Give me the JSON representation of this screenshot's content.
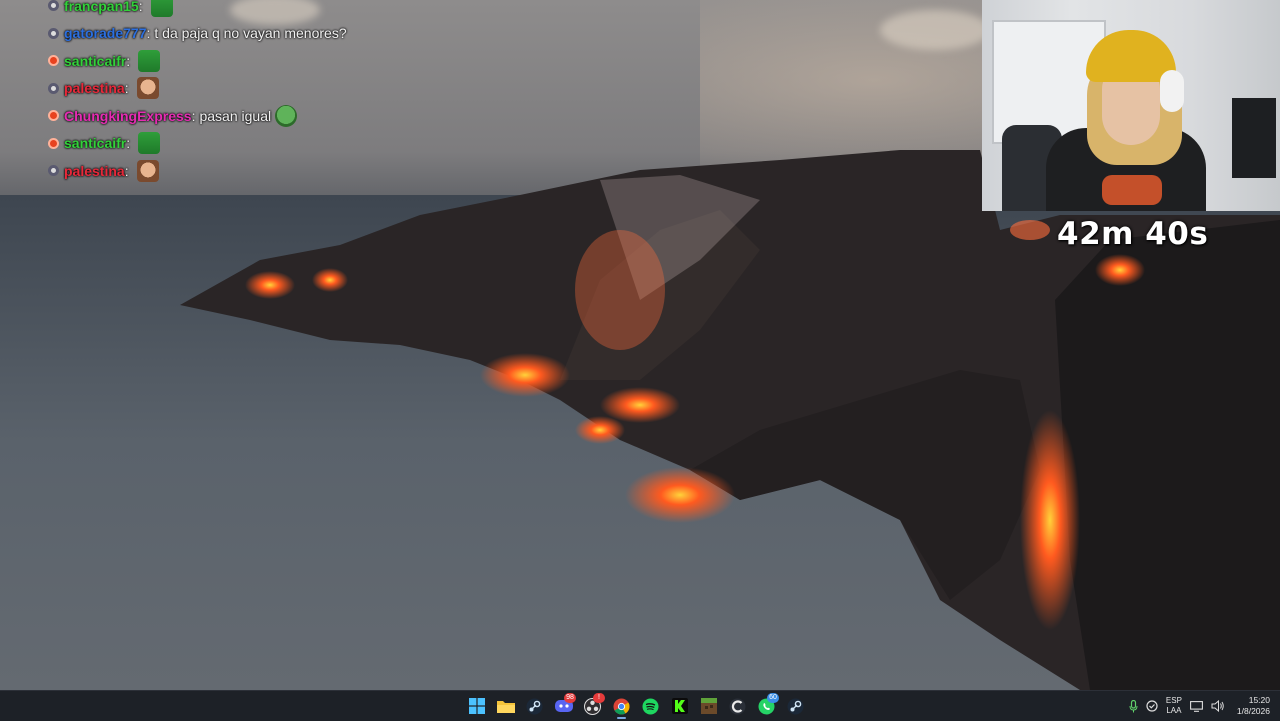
{
  "chat": {
    "messages": [
      {
        "badge": "gray",
        "user": "francpan15",
        "user_color": "#32d23a",
        "text": "",
        "emote": "green"
      },
      {
        "badge": "gray",
        "user": "gatorade777",
        "user_color": "#2b6fe0",
        "text": "t da paja q no vayan menores?",
        "emote": ""
      },
      {
        "badge": "red",
        "user": "santicaifr",
        "user_color": "#32d23a",
        "text": "",
        "emote": "green"
      },
      {
        "badge": "gray",
        "user": "palestina",
        "user_color": "#e8283a",
        "text": "",
        "emote": "face"
      },
      {
        "badge": "red",
        "user": "ChungkingExpress",
        "user_color": "#e62cb3",
        "text": "pasan igual",
        "emote": "pepe"
      },
      {
        "badge": "red",
        "user": "santicaifr",
        "user_color": "#32d23a",
        "text": "",
        "emote": "green"
      },
      {
        "badge": "gray",
        "user": "palestina",
        "user_color": "#e8283a",
        "text": "",
        "emote": "face"
      }
    ]
  },
  "timer": {
    "label": "42m 40s"
  },
  "taskbar": {
    "apps": [
      {
        "name": "start-button",
        "icon": "windows-icon",
        "active": false,
        "badge": ""
      },
      {
        "name": "file-explorer",
        "icon": "folder-icon",
        "active": false,
        "badge": ""
      },
      {
        "name": "steam",
        "icon": "steam-icon",
        "active": false,
        "badge": ""
      },
      {
        "name": "discord",
        "icon": "discord-icon",
        "active": false,
        "badge": "98"
      },
      {
        "name": "obs",
        "icon": "obs-icon",
        "active": false,
        "badge": "!"
      },
      {
        "name": "chrome",
        "icon": "chrome-icon",
        "active": true,
        "badge": ""
      },
      {
        "name": "spotify",
        "icon": "spotify-icon",
        "active": false,
        "badge": ""
      },
      {
        "name": "kick",
        "icon": "kick-icon",
        "active": false,
        "badge": ""
      },
      {
        "name": "minecraft",
        "icon": "minecraft-icon",
        "active": false,
        "badge": ""
      },
      {
        "name": "ccleaner",
        "icon": "ccleaner-icon",
        "active": false,
        "badge": ""
      },
      {
        "name": "whatsapp",
        "icon": "whatsapp-icon",
        "active": false,
        "badge": "60"
      },
      {
        "name": "steam-2",
        "icon": "steam-icon",
        "active": false,
        "badge": ""
      }
    ],
    "tray": {
      "lang_top": "ESP",
      "lang_bottom": "LAA",
      "time": "15:20",
      "date": "1/8/2026"
    }
  },
  "colors": {
    "taskbar_bg": "#1d2127",
    "lava": "#ff5a1f"
  }
}
